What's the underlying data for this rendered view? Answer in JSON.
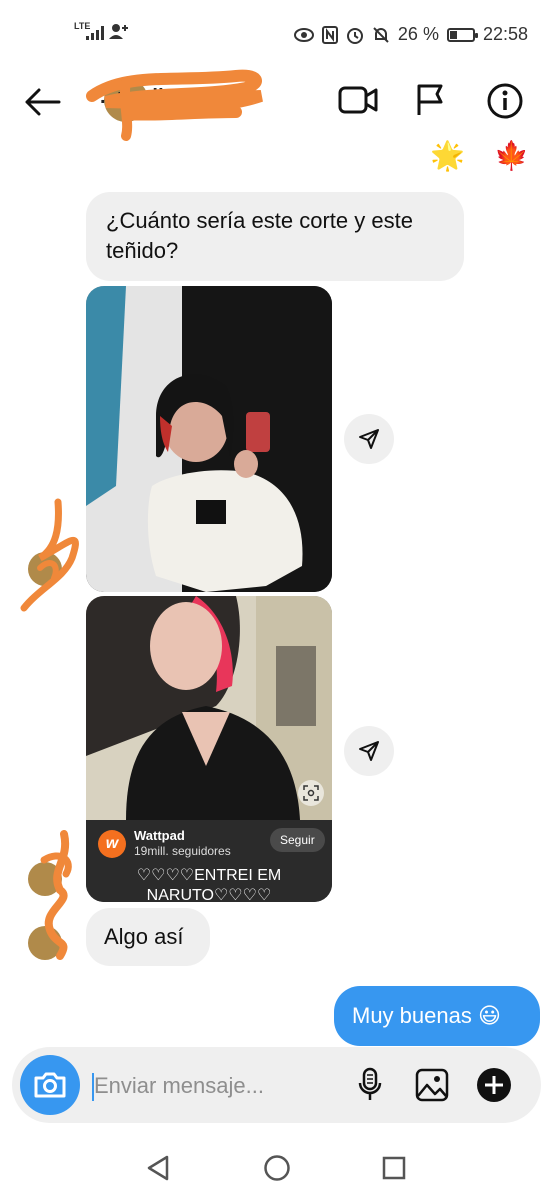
{
  "status_bar": {
    "network": "LTE",
    "battery_percent": "26 %",
    "time": "22:58",
    "icons": [
      "signal-icon",
      "user-add-icon",
      "eye-icon",
      "nfc-icon",
      "alarm-icon",
      "bell-off-icon",
      "battery-icon"
    ]
  },
  "header": {
    "title": "...uaail...",
    "back_icon": "back-arrow-icon",
    "actions": [
      "video-call-icon",
      "flag-icon",
      "info-icon"
    ],
    "reaction_emojis": [
      "🌟",
      "🍁"
    ]
  },
  "messages": {
    "m1_text": "¿Cuánto sería este corte y este teñido?",
    "card": {
      "account": "Wattpad",
      "followers": "19mill. seguidores",
      "follow_label": "Seguir",
      "caption": "♡♡♡♡ENTREI EM NARUTO♡♡♡♡"
    },
    "m4_text": "Algo así",
    "m5_text": "Muy buenas 😃"
  },
  "composer": {
    "placeholder": "Enviar mensaje..."
  },
  "colors": {
    "accent": "#3797f0",
    "incoming_bubble": "#efefef",
    "scribble": "#f0883a"
  }
}
